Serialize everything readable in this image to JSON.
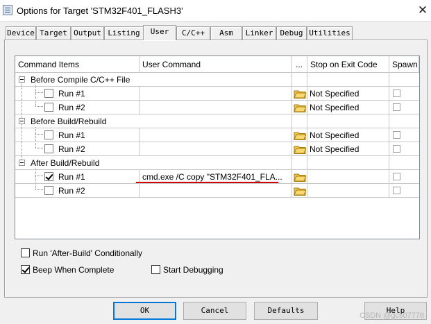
{
  "window": {
    "title": "Options for Target 'STM32F401_FLASH3'",
    "close_label": "✕"
  },
  "tabs": [
    {
      "label": "Device",
      "active": false
    },
    {
      "label": "Target",
      "active": false
    },
    {
      "label": "Output",
      "active": false
    },
    {
      "label": "Listing",
      "active": false
    },
    {
      "label": "User",
      "active": true
    },
    {
      "label": "C/C++",
      "active": false
    },
    {
      "label": "Asm",
      "active": false
    },
    {
      "label": "Linker",
      "active": false
    },
    {
      "label": "Debug",
      "active": false
    },
    {
      "label": "Utilities",
      "active": false
    }
  ],
  "grid": {
    "columns": [
      "Command Items",
      "User Command",
      "...",
      "Stop on Exit Code",
      "Spawn"
    ],
    "groups": [
      {
        "label": "Before Compile C/C++ File",
        "items": [
          {
            "label": "Run #1",
            "checked": false,
            "command": "",
            "stop": "Not Specified",
            "spawn": false
          },
          {
            "label": "Run #2",
            "checked": false,
            "command": "",
            "stop": "Not Specified",
            "spawn": false
          }
        ]
      },
      {
        "label": "Before Build/Rebuild",
        "items": [
          {
            "label": "Run #1",
            "checked": false,
            "command": "",
            "stop": "Not Specified",
            "spawn": false
          },
          {
            "label": "Run #2",
            "checked": false,
            "command": "",
            "stop": "Not Specified",
            "spawn": false
          }
        ]
      },
      {
        "label": "After Build/Rebuild",
        "items": [
          {
            "label": "Run #1",
            "checked": true,
            "command": "cmd.exe /C copy \"STM32F401_FLA...",
            "stop": "",
            "spawn": false
          },
          {
            "label": "Run #2",
            "checked": false,
            "command": "",
            "stop": "",
            "spawn": false
          }
        ]
      }
    ]
  },
  "options": {
    "run_after_build": {
      "label": "Run 'After-Build' Conditionally",
      "checked": false
    },
    "beep": {
      "label": "Beep When Complete",
      "checked": true
    },
    "start_debugging": {
      "label": "Start Debugging",
      "checked": false
    }
  },
  "buttons": {
    "ok": "OK",
    "cancel": "Cancel",
    "defaults": "Defaults",
    "help": "Help"
  },
  "watermark": "CSDN @gcs07776",
  "colors": {
    "annotation_red": "#d40000",
    "folder_yellow": "#e8b830",
    "default_button_border": "#0078d7"
  }
}
